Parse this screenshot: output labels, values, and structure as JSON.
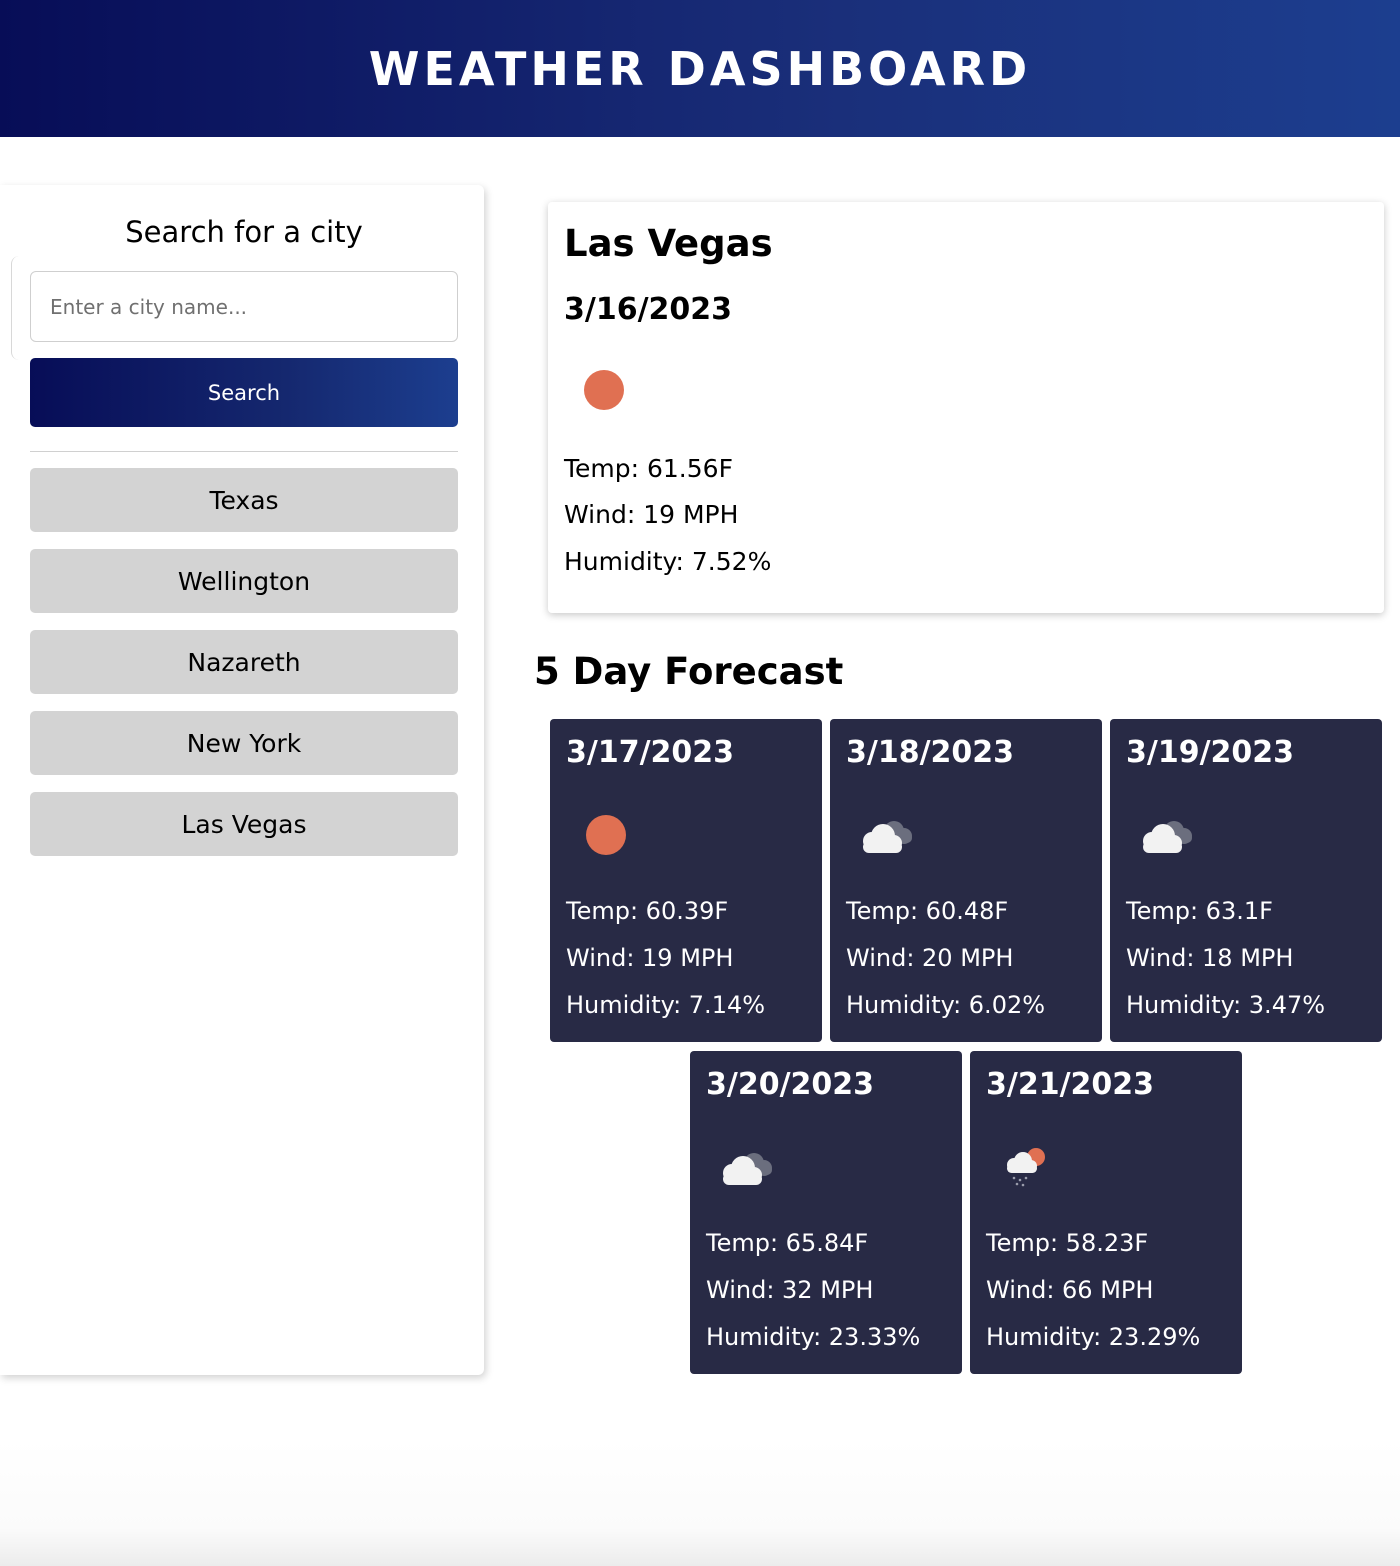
{
  "header": {
    "title": "WEATHER DASHBOARD"
  },
  "sidebar": {
    "search_title": "Search for a city",
    "search_placeholder": "Enter a city name...",
    "search_value": "",
    "search_button_label": "Search",
    "history": [
      {
        "label": "Texas"
      },
      {
        "label": "Wellington"
      },
      {
        "label": "Nazareth"
      },
      {
        "label": "New York"
      },
      {
        "label": "Las Vegas"
      }
    ]
  },
  "current": {
    "city": "Las Vegas",
    "date": "3/16/2023",
    "icon": "sun-icon",
    "temp": "Temp: 61.56F",
    "wind": "Wind: 19 MPH",
    "humidity": "Humidity: 7.52%"
  },
  "forecast": {
    "title": "5 Day Forecast",
    "days": [
      {
        "date": "3/17/2023",
        "icon": "sun-icon",
        "temp": "Temp: 60.39F",
        "wind": "Wind: 19 MPH",
        "humidity": "Humidity: 7.14%"
      },
      {
        "date": "3/18/2023",
        "icon": "clouds-icon",
        "temp": "Temp: 60.48F",
        "wind": "Wind: 20 MPH",
        "humidity": "Humidity: 6.02%"
      },
      {
        "date": "3/19/2023",
        "icon": "clouds-icon",
        "temp": "Temp: 63.1F",
        "wind": "Wind: 18 MPH",
        "humidity": "Humidity: 3.47%"
      },
      {
        "date": "3/20/2023",
        "icon": "clouds-icon",
        "temp": "Temp: 65.84F",
        "wind": "Wind: 32 MPH",
        "humidity": "Humidity: 23.33%"
      },
      {
        "date": "3/21/2023",
        "icon": "rain-sun-icon",
        "temp": "Temp: 58.23F",
        "wind": "Wind: 66 MPH",
        "humidity": "Humidity: 23.29%"
      }
    ]
  },
  "colors": {
    "header_gradient_start": "#070d57",
    "header_gradient_end": "#1c3e8f",
    "history_button_bg": "#d3d3d3",
    "forecast_card_bg": "#282a45",
    "sun_color": "#e07052"
  }
}
